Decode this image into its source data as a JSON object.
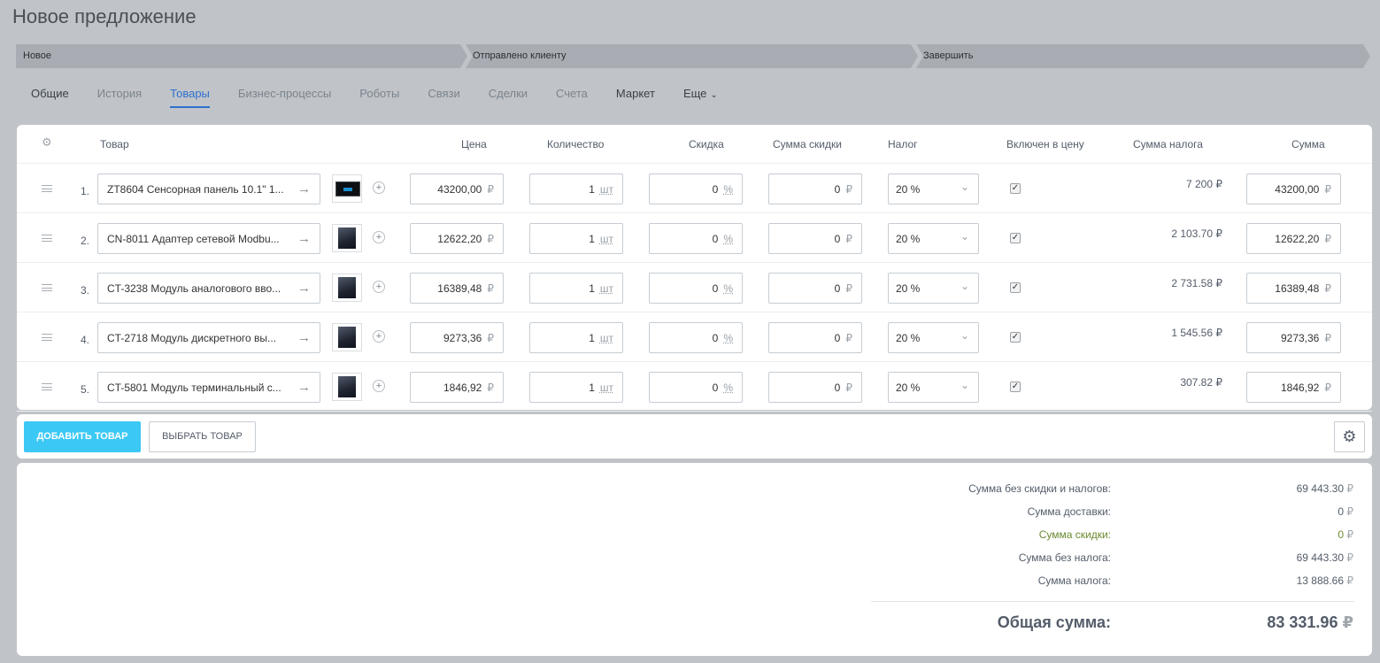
{
  "page_title": "Новое предложение",
  "stages": [
    "Новое",
    "Отправлено клиенту",
    "Завершить"
  ],
  "tabs": [
    "Общие",
    "История",
    "Товары",
    "Бизнес-процессы",
    "Роботы",
    "Связи",
    "Сделки",
    "Счета",
    "Маркет",
    "Еще"
  ],
  "active_tab": "Товары",
  "columns": {
    "product": "Товар",
    "price": "Цена",
    "quantity": "Количество",
    "discount": "Скидка",
    "discount_sum": "Сумма скидки",
    "tax": "Налог",
    "tax_included": "Включен в цену",
    "tax_sum": "Сумма налога",
    "sum": "Сумма"
  },
  "rows": [
    {
      "num": "1.",
      "name": "ZT8604 Сенсорная панель 10.1\" 1...",
      "thumb": "panel",
      "price": "43200,00",
      "qty": "1",
      "qty_unit": "шт",
      "discount": "0",
      "discount_unit": "%",
      "discount_sum": "0",
      "tax": "20 %",
      "included": true,
      "tax_sum": "7 200 ₽",
      "total": "43200,00"
    },
    {
      "num": "2.",
      "name": "CN-8011 Адаптер сетевой Modbu...",
      "thumb": "module",
      "price": "12622,20",
      "qty": "1",
      "qty_unit": "шт",
      "discount": "0",
      "discount_unit": "%",
      "discount_sum": "0",
      "tax": "20 %",
      "included": true,
      "tax_sum": "2 103.70 ₽",
      "total": "12622,20"
    },
    {
      "num": "3.",
      "name": "CT-3238 Модуль аналогового вво...",
      "thumb": "module",
      "price": "16389,48",
      "qty": "1",
      "qty_unit": "шт",
      "discount": "0",
      "discount_unit": "%",
      "discount_sum": "0",
      "tax": "20 %",
      "included": true,
      "tax_sum": "2 731.58 ₽",
      "total": "16389,48"
    },
    {
      "num": "4.",
      "name": "CT-2718 Модуль дискретного вы...",
      "thumb": "module",
      "price": "9273,36",
      "qty": "1",
      "qty_unit": "шт",
      "discount": "0",
      "discount_unit": "%",
      "discount_sum": "0",
      "tax": "20 %",
      "included": true,
      "tax_sum": "1 545.56 ₽",
      "total": "9273,36"
    },
    {
      "num": "5.",
      "name": "CT-5801 Модуль терминальный с...",
      "thumb": "module",
      "price": "1846,92",
      "qty": "1",
      "qty_unit": "шт",
      "discount": "0",
      "discount_unit": "%",
      "discount_sum": "0",
      "tax": "20 %",
      "included": true,
      "tax_sum": "307.82 ₽",
      "total": "1846,92"
    }
  ],
  "currency": "₽",
  "buttons": {
    "add_product": "ДОБАВИТЬ ТОВАР",
    "select_product": "ВЫБРАТЬ ТОВАР"
  },
  "totals": [
    {
      "label": "Сумма без скидки и налогов:",
      "value": "69 443.30",
      "highlight": false
    },
    {
      "label": "Сумма доставки:",
      "value": "0",
      "highlight": false
    },
    {
      "label": "Сумма скидки:",
      "value": "0",
      "highlight": true
    },
    {
      "label": "Сумма без налога:",
      "value": "69 443.30",
      "highlight": false
    },
    {
      "label": "Сумма налога:",
      "value": "13 888.66",
      "highlight": false
    }
  ],
  "grand_total": {
    "label": "Общая сумма:",
    "value": "83 331.96"
  },
  "colors": {
    "accent": "#2f6fcf",
    "add_button": "#3bc8f5",
    "background": "#c0c4c8"
  }
}
